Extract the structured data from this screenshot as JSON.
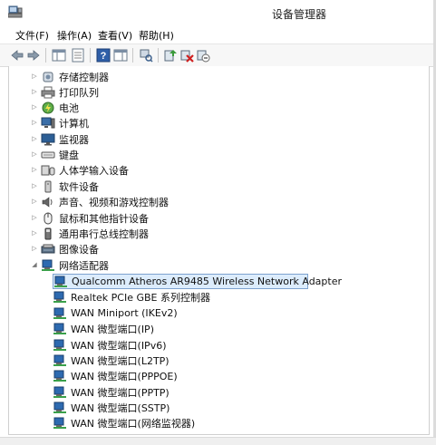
{
  "window": {
    "title": "设备管理器"
  },
  "menu": {
    "file": "文件(F)",
    "action": "操作(A)",
    "view": "查看(V)",
    "help": "帮助(H)"
  },
  "categories": [
    {
      "label": "存储控制器",
      "icon": "storage-controller-icon"
    },
    {
      "label": "打印队列",
      "icon": "printer-icon"
    },
    {
      "label": "电池",
      "icon": "battery-icon"
    },
    {
      "label": "计算机",
      "icon": "computer-icon"
    },
    {
      "label": "监视器",
      "icon": "monitor-icon"
    },
    {
      "label": "键盘",
      "icon": "keyboard-icon"
    },
    {
      "label": "人体学输入设备",
      "icon": "hid-icon"
    },
    {
      "label": "软件设备",
      "icon": "software-device-icon"
    },
    {
      "label": "声音、视频和游戏控制器",
      "icon": "sound-icon"
    },
    {
      "label": "鼠标和其他指针设备",
      "icon": "mouse-icon"
    },
    {
      "label": "通用串行总线控制器",
      "icon": "usb-icon"
    },
    {
      "label": "图像设备",
      "icon": "imaging-device-icon"
    },
    {
      "label": "网络适配器",
      "icon": "network-adapter-icon",
      "expanded": true
    }
  ],
  "network_adapters": [
    {
      "label": "Qualcomm Atheros AR9485 Wireless Network Adapter",
      "selected": true
    },
    {
      "label": "Realtek PCIe GBE 系列控制器"
    },
    {
      "label": "WAN Miniport (IKEv2)"
    },
    {
      "label": "WAN 微型端口(IP)"
    },
    {
      "label": "WAN 微型端口(IPv6)"
    },
    {
      "label": "WAN 微型端口(L2TP)"
    },
    {
      "label": "WAN 微型端口(PPPOE)"
    },
    {
      "label": "WAN 微型端口(PPTP)"
    },
    {
      "label": "WAN 微型端口(SSTP)"
    },
    {
      "label": "WAN 微型端口(网络监视器)"
    }
  ],
  "colors": {
    "selection_bg": "#dcecfc",
    "selection_border": "#7da2ce"
  }
}
